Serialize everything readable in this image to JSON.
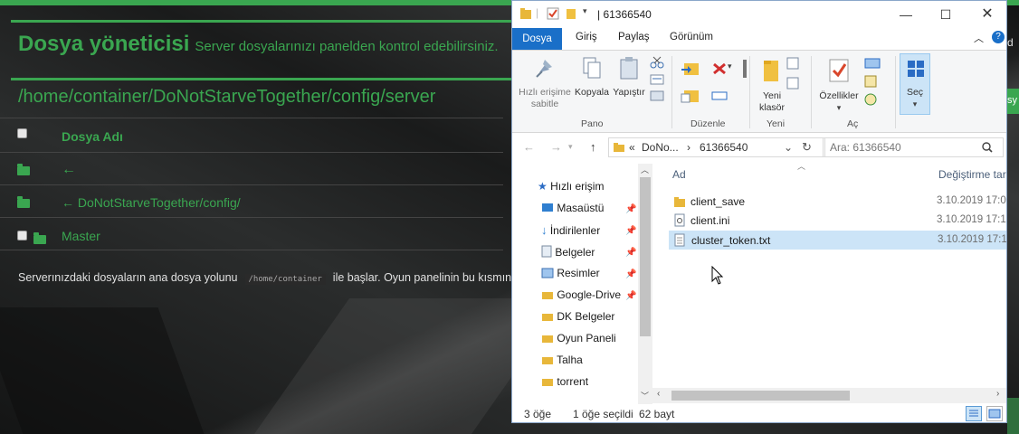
{
  "web": {
    "title": "Dosya yöneticisi",
    "subtitle": "Server dosyalarınızı panelden kontrol edebilirsiniz.",
    "path": "/home/container/DoNotStarveTogether/config/server",
    "column_header": "Dosya Adı",
    "rows": [
      {
        "label": "←"
      },
      {
        "label": "← DoNotStarveTogether/config/"
      },
      {
        "label": "Master"
      }
    ],
    "info_before": "Serverınızdaki dosyaların ana dosya yolunu",
    "info_code": "/home/container",
    "info_after": "ile başlar. Oyun panelinin bu kısmından r",
    "right_edge_text": "d",
    "right_edge_btn": "sy",
    "accent_color": "#3aa650"
  },
  "explorer": {
    "window_title": "61366540",
    "quick_access_icons": [
      "folder-icon",
      "properties-check-icon",
      "new-folder-icon",
      "dropdown-arrow-icon"
    ],
    "ribbon_tabs": [
      "Dosya",
      "Giriş",
      "Paylaş",
      "Görünüm"
    ],
    "active_tab": "Dosya",
    "ribbon": {
      "pin_label": "Hızlı erişime sabitle",
      "copy_label": "Kopyala",
      "paste_label": "Yapıştır",
      "group_clipboard": "Pano",
      "group_organize": "Düzenle",
      "new_folder_label": "Yeni klasör",
      "group_new": "Yeni",
      "properties_label": "Özellikler",
      "group_open": "Aç",
      "select_label": "Seç"
    },
    "address": {
      "parts": [
        "«",
        "DoNo...",
        "›",
        "61366540"
      ],
      "search_placeholder": "Ara: 61366540"
    },
    "nav": [
      {
        "label": "Hızlı erişim",
        "icon": "star-icon",
        "pinned": false
      },
      {
        "label": "Masaüstü",
        "icon": "desktop-icon",
        "pinned": true
      },
      {
        "label": "İndirilenler",
        "icon": "download-icon",
        "pinned": true
      },
      {
        "label": "Belgeler",
        "icon": "documents-icon",
        "pinned": true
      },
      {
        "label": "Resimler",
        "icon": "pictures-icon",
        "pinned": true
      },
      {
        "label": "Google-Drive",
        "icon": "folder-icon",
        "pinned": true
      },
      {
        "label": "DK Belgeler",
        "icon": "folder-icon",
        "pinned": false
      },
      {
        "label": "Oyun Paneli",
        "icon": "folder-icon",
        "pinned": false
      },
      {
        "label": "Talha",
        "icon": "folder-icon",
        "pinned": false
      },
      {
        "label": "torrent",
        "icon": "folder-icon",
        "pinned": false
      }
    ],
    "columns": {
      "name": "Ad",
      "modified": "Değiştirme tari"
    },
    "files": [
      {
        "name": "client_save",
        "type": "folder",
        "modified": "3.10.2019 17:0",
        "selected": false
      },
      {
        "name": "client.ini",
        "type": "ini",
        "modified": "3.10.2019 17:1",
        "selected": false
      },
      {
        "name": "cluster_token.txt",
        "type": "txt",
        "modified": "3.10.2019 17:1",
        "selected": true
      }
    ],
    "status": {
      "count": "3 öğe",
      "selected": "1 öğe seçildi",
      "size": "62 bayt"
    }
  }
}
